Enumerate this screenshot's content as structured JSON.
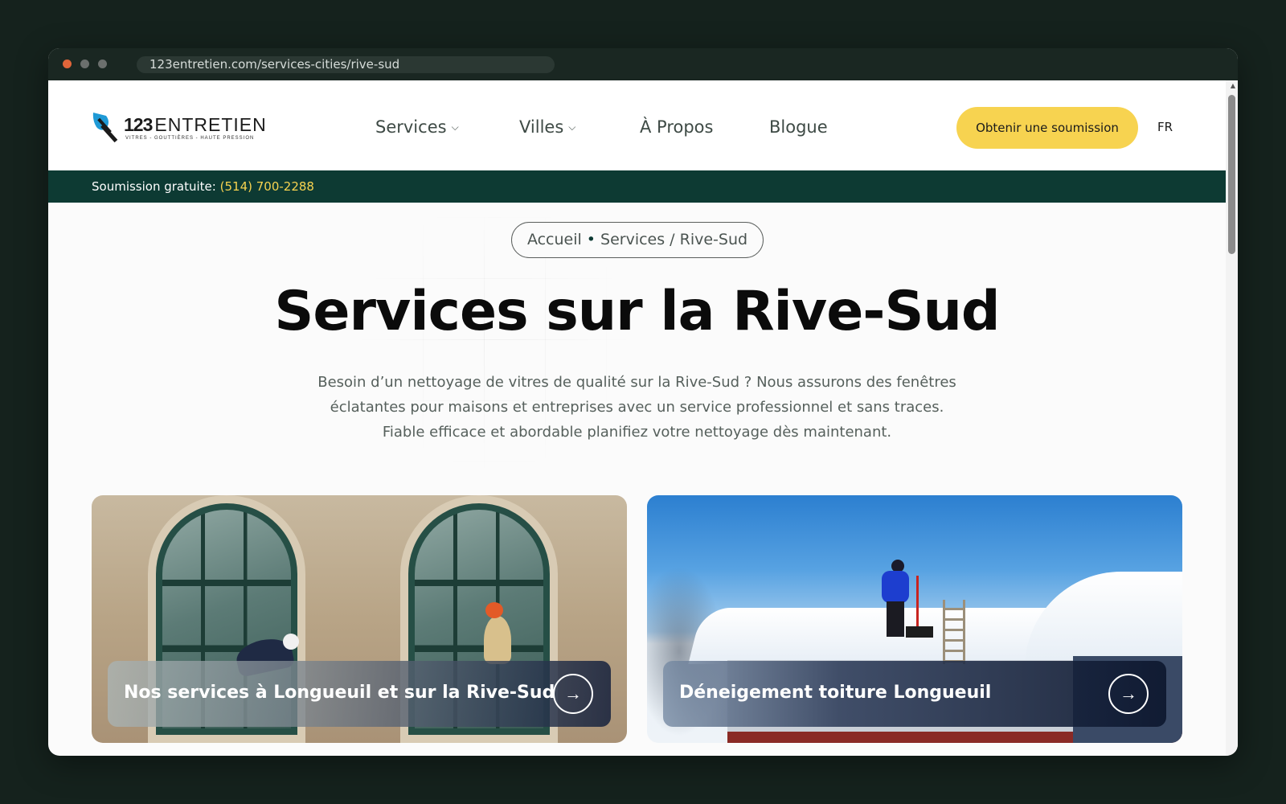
{
  "browser": {
    "url": "123entretien.com/services-cities/rive-sud"
  },
  "header": {
    "logo": {
      "number": "123",
      "name": "ENTRETIEN",
      "tagline": "VITRES - GOUTTIÈRES - HAUTE PRESSION"
    },
    "nav": [
      {
        "label": "Services",
        "has_dropdown": true
      },
      {
        "label": "Villes",
        "has_dropdown": true
      },
      {
        "label": "À Propos",
        "has_dropdown": false
      },
      {
        "label": "Blogue",
        "has_dropdown": false
      }
    ],
    "cta_label": "Obtenir une soumission",
    "language": "FR"
  },
  "phonebar": {
    "label": "Soumission gratuite:",
    "phone": "(514) 700-2288"
  },
  "hero": {
    "breadcrumb": {
      "home": "Accueil",
      "separator": "•",
      "current": "Services / Rive-Sud"
    },
    "title": "Services sur la Rive-Sud",
    "description": "Besoin d’un nettoyage de vitres de qualité sur la Rive-Sud ? Nous assurons des fenêtres éclatantes pour maisons et entreprises avec un service professionnel et sans traces. Fiable efficace et abordable planifiez votre nettoyage dès maintenant."
  },
  "cards": [
    {
      "title": "Nos services à Longueuil et sur la Rive-Sud",
      "arrow": "→"
    },
    {
      "title": "Déneigement toiture Longueuil",
      "arrow": "→"
    }
  ],
  "colors": {
    "brand_dark": "#0d3a33",
    "accent_yellow": "#f7d350",
    "logo_blue": "#1f9ad6"
  }
}
